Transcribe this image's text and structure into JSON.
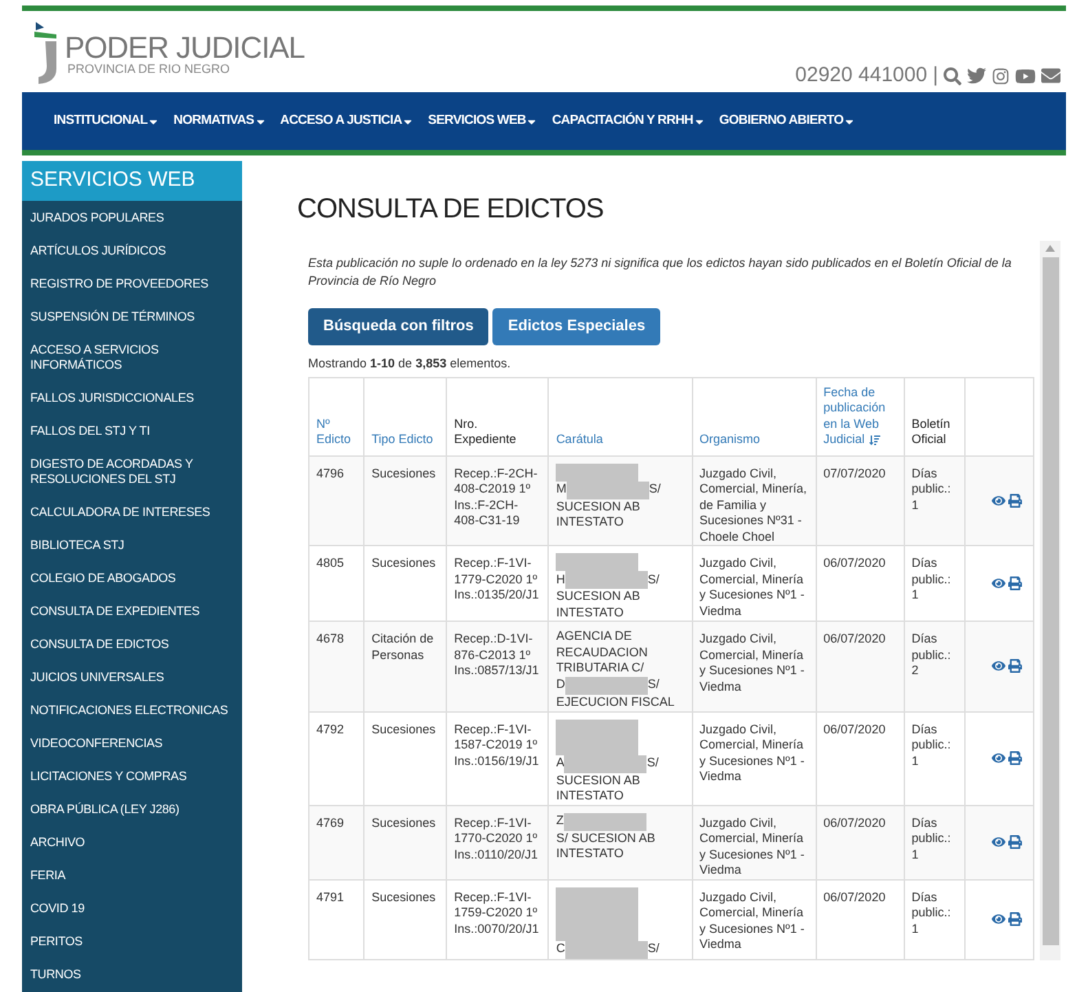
{
  "header": {
    "logo_title": "PODER JUDICIAL",
    "logo_subtitle": "PROVINCIA DE RIO NEGRO",
    "phone": "02920 441000",
    "separator": "|"
  },
  "nav": {
    "items": [
      "INSTITUCIONAL",
      "NORMATIVAS",
      "ACCESO A JUSTICIA",
      "SERVICIOS WEB",
      "CAPACITACIÓN Y RRHH",
      "GOBIERNO ABIERTO"
    ]
  },
  "sidebar": {
    "title": "SERVICIOS WEB",
    "items": [
      "JURADOS POPULARES",
      "ARTÍCULOS JURÍDICOS",
      "REGISTRO DE PROVEEDORES",
      "SUSPENSIÓN DE TÉRMINOS",
      "ACCESO A SERVICIOS INFORMÁTICOS",
      "FALLOS JURISDICCIONALES",
      "FALLOS DEL STJ Y TI",
      "DIGESTO DE ACORDADAS Y RESOLUCIONES DEL STJ",
      "CALCULADORA DE INTERESES",
      "BIBLIOTECA STJ",
      "COLEGIO DE ABOGADOS",
      "CONSULTA DE EXPEDIENTES",
      "CONSULTA DE EDICTOS",
      "JUICIOS UNIVERSALES",
      "NOTIFICACIONES ELECTRONICAS",
      "VIDEOCONFERENCIAS",
      "LICITACIONES Y COMPRAS",
      "OBRA PÚBLICA (LEY J286)",
      "ARCHIVO",
      "FERIA",
      "COVID 19",
      "PERITOS",
      "TURNOS"
    ]
  },
  "main": {
    "title": "CONSULTA DE EDICTOS",
    "notice": "Esta publicación no suple lo ordenado en la ley 5273 ni significa que los edictos hayan sido publicados en el Boletín Oficial de la Provincia de Río Negro",
    "buttons": [
      {
        "label": "Búsqueda con filtros",
        "selected": true
      },
      {
        "label": "Edictos Especiales",
        "selected": false
      }
    ],
    "summary": "Mostrando **1-10** de **3,853** elementos.",
    "table": {
      "columns": [
        {
          "label": "Nº Edicto",
          "sortable": true,
          "sorted": false
        },
        {
          "label": "Tipo Edicto",
          "sortable": true,
          "sorted": false
        },
        {
          "label": "Nro. Expediente",
          "sortable": false,
          "sorted": false
        },
        {
          "label": "Carátula",
          "sortable": true,
          "sorted": false
        },
        {
          "label": "Organismo",
          "sortable": true,
          "sorted": false
        },
        {
          "label": "Fecha de publicación en la Web Judicial",
          "sortable": true,
          "sorted": true
        },
        {
          "label": "Boletín Oficial",
          "sortable": false,
          "sorted": false
        }
      ],
      "rows": [
        {
          "numero": "4796",
          "tipo": "Sucesiones",
          "expediente": "Recep.:F-2CH-408-C2019 1º Ins.:F-2CH-408-C31-19",
          "caratula": [
            [
              {
                "kind": "redacted"
              }
            ],
            [
              {
                "kind": "text",
                "text": "M"
              },
              {
                "kind": "redacted"
              },
              {
                "kind": "text",
                "text": "S/"
              }
            ],
            [
              {
                "kind": "text",
                "text": "SUCESION AB INTESTATO"
              }
            ]
          ],
          "organismo": "Juzgado Civil, Comercial, Minería, de Familia y Sucesiones Nº31 - Choele Choel",
          "fecha": "07/07/2020",
          "boletin": "Días public.: 1"
        },
        {
          "numero": "4805",
          "tipo": "Sucesiones",
          "expediente": "Recep.:F-1VI-1779-C2020 1º Ins.:0135/20/J1",
          "caratula": [
            [
              {
                "kind": "redacted"
              }
            ],
            [
              {
                "kind": "text",
                "text": "H"
              },
              {
                "kind": "redacted"
              },
              {
                "kind": "text",
                "text": "S/"
              }
            ],
            [
              {
                "kind": "text",
                "text": "SUCESION AB INTESTATO"
              }
            ]
          ],
          "organismo": "Juzgado Civil, Comercial, Minería y Sucesiones Nº1 - Viedma",
          "fecha": "06/07/2020",
          "boletin": "Días public.: 1"
        },
        {
          "numero": "4678",
          "tipo": "Citación de Personas",
          "expediente": "Recep.:D-1VI-876-C2013 1º Ins.:0857/13/J1",
          "caratula": [
            [
              {
                "kind": "text",
                "text": "AGENCIA DE RECAUDACION TRIBUTARIA C/"
              }
            ],
            [
              {
                "kind": "text",
                "text": "D"
              },
              {
                "kind": "redacted"
              },
              {
                "kind": "text",
                "text": "S/"
              }
            ],
            [
              {
                "kind": "text",
                "text": "EJECUCION FISCAL"
              }
            ]
          ],
          "organismo": "Juzgado Civil, Comercial, Minería y Sucesiones Nº1 - Viedma",
          "fecha": "06/07/2020",
          "boletin": "Días public.: 2"
        },
        {
          "numero": "4792",
          "tipo": "Sucesiones",
          "expediente": "Recep.:F-1VI-1587-C2019 1º Ins.:0156/19/J1",
          "caratula": [
            [
              {
                "kind": "redacted"
              }
            ],
            [
              {
                "kind": "redacted"
              }
            ],
            [
              {
                "kind": "text",
                "text": "A"
              },
              {
                "kind": "redacted"
              },
              {
                "kind": "text",
                "text": "S/"
              }
            ],
            [
              {
                "kind": "text",
                "text": "SUCESION AB INTESTATO"
              }
            ]
          ],
          "organismo": "Juzgado Civil, Comercial, Minería y Sucesiones Nº1 - Viedma",
          "fecha": "06/07/2020",
          "boletin": "Días public.: 1"
        },
        {
          "numero": "4769",
          "tipo": "Sucesiones",
          "expediente": "Recep.:F-1VI-1770-C2020 1º Ins.:0110/20/J1",
          "caratula": [
            [
              {
                "kind": "text",
                "text": "Z"
              },
              {
                "kind": "redacted"
              }
            ],
            [
              {
                "kind": "text",
                "text": "S/ SUCESION AB INTESTATO"
              }
            ]
          ],
          "organismo": "Juzgado Civil, Comercial, Minería y Sucesiones Nº1 - Viedma",
          "fecha": "06/07/2020",
          "boletin": "Días public.: 1"
        },
        {
          "numero": "4791",
          "tipo": "Sucesiones",
          "expediente": "Recep.:F-1VI-1759-C2020 1º Ins.:0070/20/J1",
          "caratula": [
            [
              {
                "kind": "redacted"
              }
            ],
            [
              {
                "kind": "redacted"
              }
            ],
            [
              {
                "kind": "redacted"
              }
            ],
            [
              {
                "kind": "text",
                "text": "C"
              },
              {
                "kind": "redacted"
              },
              {
                "kind": "text",
                "text": "S/"
              }
            ]
          ],
          "organismo": "Juzgado Civil, Comercial, Minería y Sucesiones Nº1 - Viedma",
          "fecha": "06/07/2020",
          "boletin": "Días public.: 1"
        }
      ]
    }
  }
}
